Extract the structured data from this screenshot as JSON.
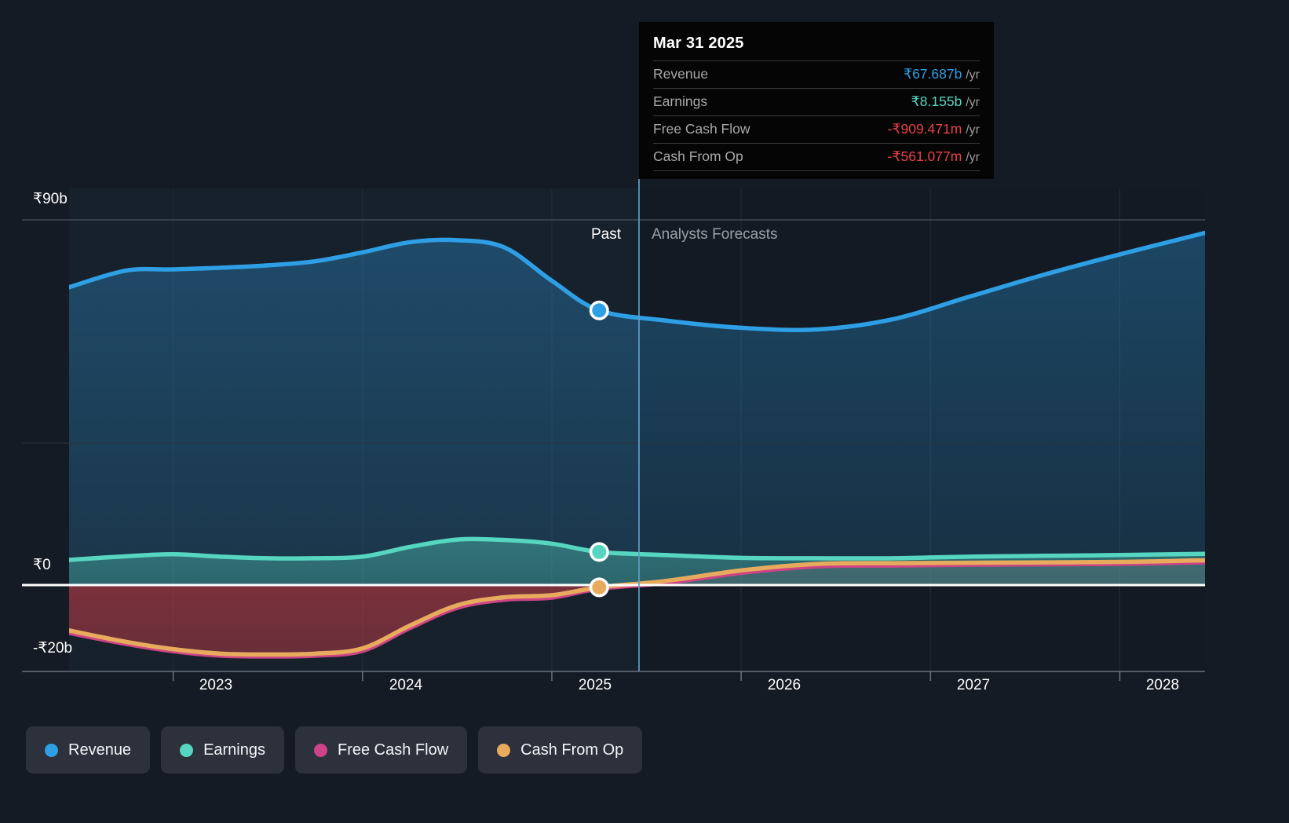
{
  "tooltip": {
    "title": "Mar 31 2025",
    "rows": [
      {
        "label": "Revenue",
        "value": "₹67.687b",
        "unit": "/yr",
        "color": "#2e9fe5"
      },
      {
        "label": "Earnings",
        "value": "₹8.155b",
        "unit": "/yr",
        "color": "#56d6c0"
      },
      {
        "label": "Free Cash Flow",
        "value": "-₹909.471m",
        "unit": "/yr",
        "color": "#e8414a"
      },
      {
        "label": "Cash From Op",
        "value": "-₹561.077m",
        "unit": "/yr",
        "color": "#e8414a"
      }
    ]
  },
  "phase": {
    "past": "Past",
    "forecast": "Analysts Forecasts"
  },
  "legend": [
    {
      "label": "Revenue",
      "color": "#2e9fe5"
    },
    {
      "label": "Earnings",
      "color": "#56d6c0"
    },
    {
      "label": "Free Cash Flow",
      "color": "#cc4386"
    },
    {
      "label": "Cash From Op",
      "color": "#e8ab5e"
    }
  ],
  "chart_data": {
    "type": "area",
    "title": "",
    "xlabel": "",
    "ylabel": "",
    "ylim": [
      -20,
      90
    ],
    "grid": true,
    "legend_position": "bottom-left",
    "currency": "₹",
    "divider_x_value": 2025.25,
    "divider_label": "Mar 31 2025",
    "y_ticks": [
      {
        "value": 90,
        "label": "₹90b"
      },
      {
        "value": 35,
        "label": ""
      },
      {
        "value": 0,
        "label": "₹0"
      },
      {
        "value": -20,
        "label": "-₹20b"
      }
    ],
    "x_ticks": [
      {
        "value": 2023,
        "label": "2023"
      },
      {
        "value": 2024,
        "label": "2024"
      },
      {
        "value": 2025,
        "label": "2025"
      },
      {
        "value": 2026,
        "label": "2026"
      },
      {
        "value": 2027,
        "label": "2027"
      },
      {
        "value": 2028,
        "label": "2028"
      }
    ],
    "x": [
      2022.45,
      2022.75,
      2023.0,
      2023.25,
      2023.5,
      2023.75,
      2024.0,
      2024.25,
      2024.5,
      2024.75,
      2025.0,
      2025.25,
      2025.6,
      2026.0,
      2026.4,
      2026.8,
      2027.2,
      2027.6,
      2028.0,
      2028.45
    ],
    "series": [
      {
        "name": "Revenue",
        "color": "#2e9fe5",
        "unit": "b",
        "values": [
          73.4,
          77.5,
          77.8,
          78.2,
          78.8,
          79.8,
          82.0,
          84.5,
          85.0,
          83.2,
          75.0,
          67.687,
          65.2,
          63.4,
          63.0,
          65.5,
          71.0,
          76.5,
          81.5,
          86.8
        ]
      },
      {
        "name": "Earnings",
        "color": "#56d6c0",
        "unit": "b",
        "values": [
          6.2,
          7.1,
          7.6,
          7.0,
          6.6,
          6.6,
          7.0,
          9.4,
          11.2,
          11.1,
          10.2,
          8.155,
          7.4,
          6.7,
          6.6,
          6.6,
          7.0,
          7.2,
          7.4,
          7.7
        ]
      },
      {
        "name": "Free Cash Flow",
        "color": "#cc4386",
        "unit": "b",
        "values": [
          -11.8,
          -14.5,
          -16.3,
          -17.4,
          -17.6,
          -17.4,
          -16.2,
          -10.6,
          -5.6,
          -3.6,
          -3.1,
          -0.909,
          0.5,
          3.0,
          4.6,
          4.8,
          5.0,
          5.1,
          5.2,
          5.6
        ]
      },
      {
        "name": "Cash From Op",
        "color": "#e8ab5e",
        "unit": "b",
        "values": [
          -11.2,
          -14.0,
          -15.8,
          -16.9,
          -17.1,
          -16.9,
          -15.6,
          -10.0,
          -5.0,
          -3.0,
          -2.5,
          -0.561,
          1.0,
          3.6,
          5.2,
          5.4,
          5.5,
          5.6,
          5.7,
          6.1
        ]
      }
    ],
    "markers": [
      {
        "series": "Revenue",
        "x": 2025.25,
        "y": 67.687
      },
      {
        "series": "Earnings",
        "x": 2025.25,
        "y": 8.155
      },
      {
        "series": "Cash From Op",
        "x": 2025.25,
        "y": -0.561
      }
    ]
  }
}
